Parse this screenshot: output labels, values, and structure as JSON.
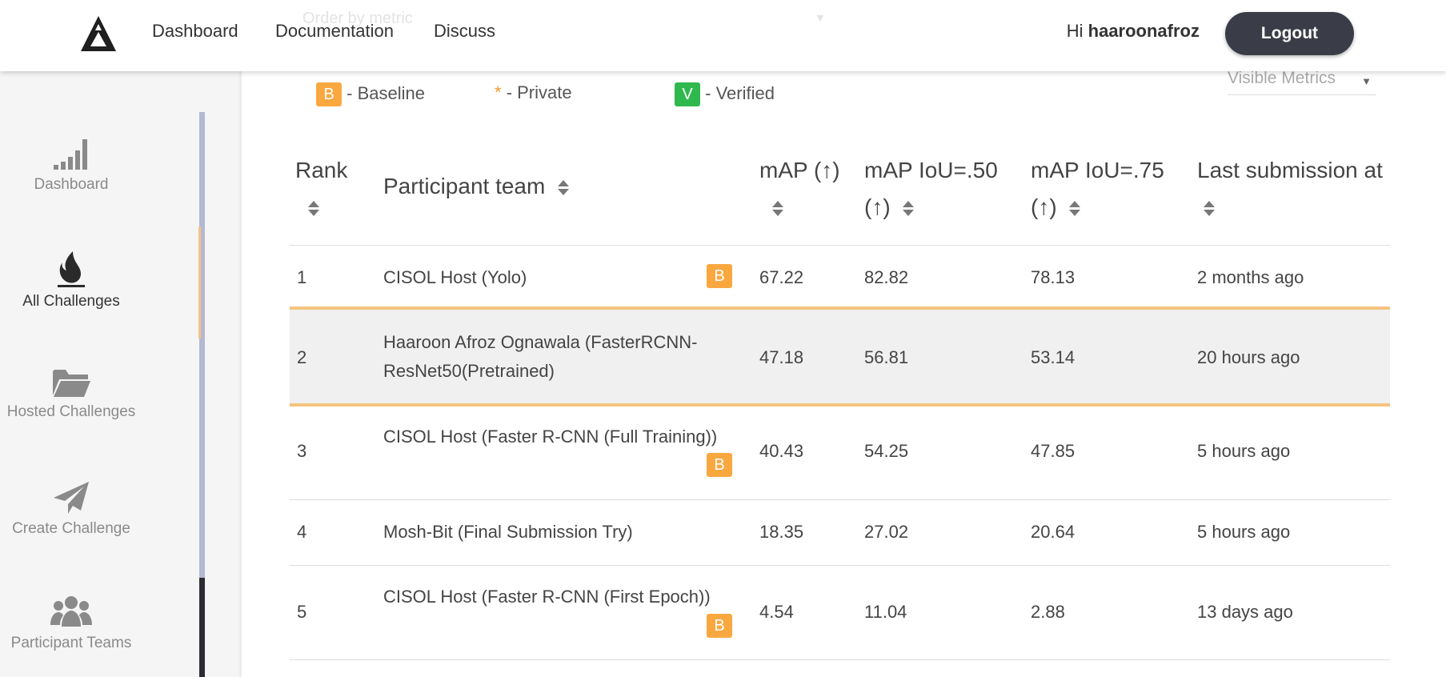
{
  "header": {
    "nav": [
      "Dashboard",
      "Documentation",
      "Discuss"
    ],
    "greeting_prefix": "Hi",
    "username": "haaroonafroz",
    "logout_label": "Logout",
    "order_by_placeholder": "Order by metric"
  },
  "sidebar": {
    "items": [
      {
        "label": "Dashboard",
        "icon": "signal-bars-icon"
      },
      {
        "label": "All Challenges",
        "icon": "flame-icon",
        "active": true
      },
      {
        "label": "Hosted Challenges",
        "icon": "folder-open-icon"
      },
      {
        "label": "Create Challenge",
        "icon": "paper-plane-icon"
      },
      {
        "label": "Participant Teams",
        "icon": "users-icon"
      }
    ]
  },
  "legend": {
    "baseline_badge": "B",
    "baseline_label": "- Baseline",
    "private_mark": "*",
    "private_label": "- Private",
    "verified_badge": "V",
    "verified_label": "- Verified"
  },
  "visible_metrics_label": "Visible Metrics",
  "table": {
    "headers": [
      "Rank",
      "Participant team",
      "mAP (↑)",
      "mAP IoU=.50 (↑)",
      "mAP IoU=.75 (↑)",
      "Last submission at"
    ],
    "rows": [
      {
        "rank": "1",
        "team": "CISOL Host (Yolo)",
        "baseline": true,
        "map": "67.22",
        "map50": "82.82",
        "map75": "78.13",
        "last": "2 months ago"
      },
      {
        "rank": "2",
        "team": "Haaroon Afroz Ognawala (FasterRCNN-ResNet50(Pretrained)",
        "baseline": false,
        "highlighted": true,
        "map": "47.18",
        "map50": "56.81",
        "map75": "53.14",
        "last": "20 hours ago"
      },
      {
        "rank": "3",
        "team": "CISOL Host (Faster R-CNN (Full Training))",
        "baseline": true,
        "map": "40.43",
        "map50": "54.25",
        "map75": "47.85",
        "last": "5 hours ago"
      },
      {
        "rank": "4",
        "team": "Mosh-Bit (Final Submission Try)",
        "baseline": false,
        "map": "18.35",
        "map50": "27.02",
        "map75": "20.64",
        "last": "5 hours ago"
      },
      {
        "rank": "5",
        "team": "CISOL Host (Faster R-CNN (First Epoch))",
        "baseline": true,
        "map": "4.54",
        "map50": "11.04",
        "map75": "2.88",
        "last": "13 days ago"
      }
    ],
    "baseline_badge": "B"
  },
  "colors": {
    "accent_orange": "#f9a840",
    "verified_green": "#2fb84e",
    "logout_bg": "#3a3d47"
  }
}
